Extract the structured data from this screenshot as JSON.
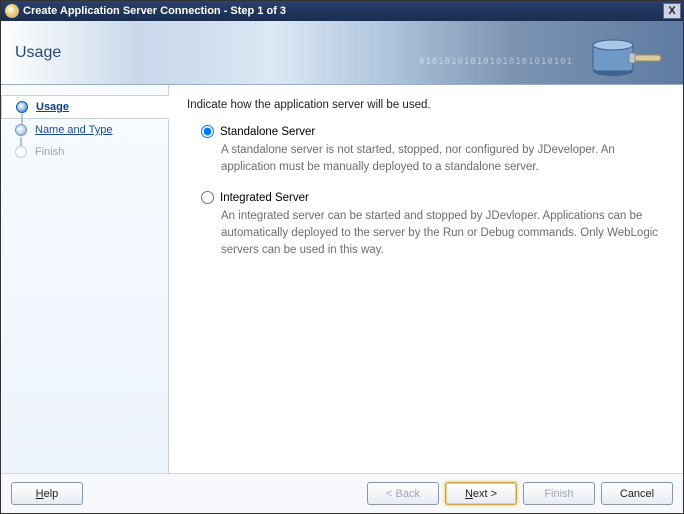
{
  "window": {
    "title": "Create Application Server Connection - Step 1 of 3",
    "close": "X"
  },
  "banner": {
    "heading": "Usage",
    "binary": "010101010101010101010101"
  },
  "steps": {
    "usage": "Usage",
    "name_type": "Name and Type",
    "finish": "Finish"
  },
  "main": {
    "prompt": "Indicate how the application server will be used.",
    "options": [
      {
        "key": "standalone",
        "label": "Standalone Server",
        "desc": "A standalone server is not started, stopped, nor configured by JDeveloper. An application must be manually deployed to a standalone server.",
        "selected": true
      },
      {
        "key": "integrated",
        "label": "Integrated Server",
        "desc": "An integrated server can be started and stopped by JDevloper. Applications can be automatically deployed to the server by the Run or Debug commands. Only WebLogic servers can be used in this way.",
        "selected": false
      }
    ]
  },
  "buttons": {
    "help": "Help",
    "back": "< Back",
    "next": "Next >",
    "finish": "Finish",
    "cancel": "Cancel"
  }
}
